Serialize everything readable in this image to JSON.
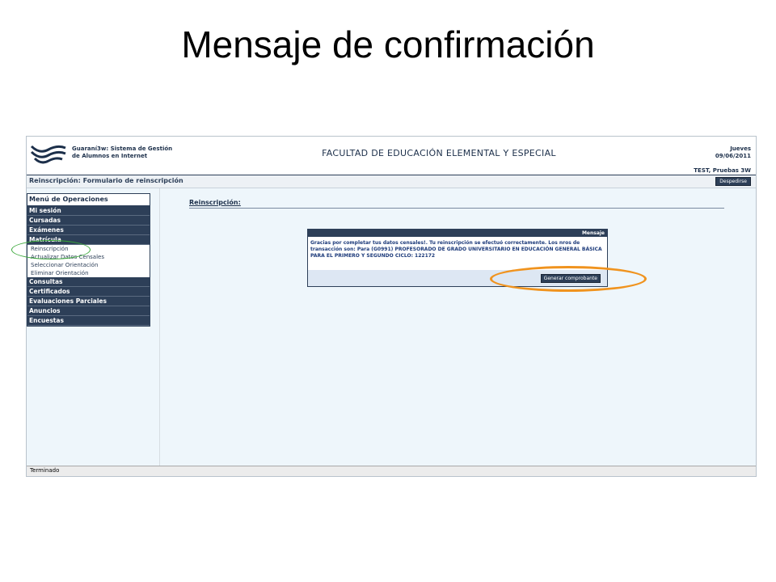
{
  "slide": {
    "title": "Mensaje de confirmación"
  },
  "header": {
    "system_line1": "Guaraní3w: Sistema de Gestión",
    "system_line2": "de Alumnos en Internet",
    "faculty": "FACULTAD DE EDUCACIÓN ELEMENTAL Y ESPECIAL",
    "day": "Jueves",
    "date": "09/06/2011",
    "user": "TEST, Pruebas 3W"
  },
  "breadcrumb": {
    "label": "Reinscripción: Formulario de reinscripción",
    "logout_label": "Despedirse"
  },
  "menu": {
    "title": "Menú de Operaciones",
    "items_top": [
      "Mi sesión",
      "Cursadas",
      "Exámenes",
      "Matrícula"
    ],
    "sub_items": [
      "Reinscripción",
      "Actualizar Datos Censales",
      "Seleccionar Orientación",
      "Eliminar Orientación"
    ],
    "items_bottom": [
      "Consultas",
      "Certificados",
      "Evaluaciones Parciales",
      "Anuncios",
      "Encuestas"
    ]
  },
  "main": {
    "section_title": "Reinscripción:",
    "message": {
      "header": "Mensaje",
      "body": "Gracias por completar tus datos censales!. Tu reinscripción se efectuó correctamente. Los nros de transacción son: Para (G0991) PROFESORADO DE GRADO UNIVERSITARIO EN EDUCACIÓN GENERAL BÁSICA PARA EL PRIMERO Y SEGUNDO CICLO: 122172",
      "button_label": "Generar comprobante"
    }
  },
  "status_bar": {
    "text": "Terminado"
  },
  "colors": {
    "brand_dark": "#2d3f58",
    "highlight_orange": "#f0931e",
    "highlight_green": "#3aa83a"
  }
}
